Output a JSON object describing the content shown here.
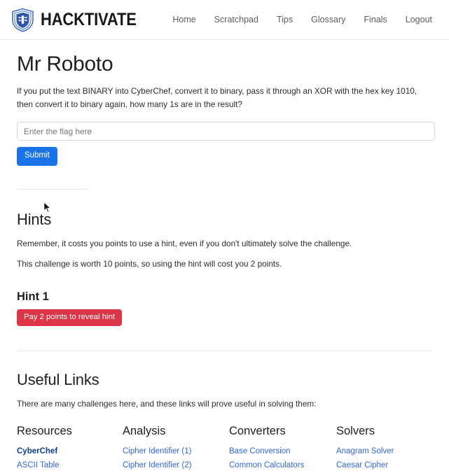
{
  "header": {
    "brand_name": "HACKTIVATE",
    "logo_icon": "shield-circuit-icon",
    "nav": [
      {
        "label": "Home"
      },
      {
        "label": "Scratchpad"
      },
      {
        "label": "Tips"
      },
      {
        "label": "Glossary"
      },
      {
        "label": "Finals"
      },
      {
        "label": "Logout"
      }
    ]
  },
  "challenge": {
    "title": "Mr Roboto",
    "prompt": "If you put the text BINARY into CyberChef, convert it to binary, pass it through an XOR with the hex key 1010, then convert it to binary again, how many 1s are in the result?",
    "flag_placeholder": "Enter the flag here",
    "flag_value": "",
    "submit_label": "Submit"
  },
  "hints": {
    "heading": "Hints",
    "note_1": "Remember, it costs you points to use a hint, even if you don't ultimately solve the challenge.",
    "note_2": "This challenge is worth 10 points, so using the hint will cost you 2 points.",
    "hint_1_title": "Hint 1",
    "hint_1_button": "Pay 2 points to reveal hint"
  },
  "useful_links": {
    "heading": "Useful Links",
    "intro": "There are many challenges here, and these links will prove useful in solving them:",
    "columns": [
      {
        "heading": "Resources",
        "items": [
          {
            "label": "CyberChef",
            "emphasis": true
          },
          {
            "label": "ASCII Table",
            "emphasis": false
          }
        ]
      },
      {
        "heading": "Analysis",
        "items": [
          {
            "label": "Cipher Identifier (1)",
            "emphasis": false
          },
          {
            "label": "Cipher Identifier (2)",
            "emphasis": false
          }
        ]
      },
      {
        "heading": "Converters",
        "items": [
          {
            "label": "Base Conversion",
            "emphasis": false
          },
          {
            "label": "Common Calculators",
            "emphasis": false
          }
        ]
      },
      {
        "heading": "Solvers",
        "items": [
          {
            "label": "Anagram Solver",
            "emphasis": false
          },
          {
            "label": "Caesar Cipher",
            "emphasis": false
          }
        ]
      }
    ]
  },
  "colors": {
    "brand_blue": "#1a73e8",
    "link_blue": "#3367d6",
    "visited_link_blue": "#0b3f96",
    "danger_red": "#dc3545",
    "nav_gray": "#5c6066",
    "logo_blue": "#3a63b8"
  }
}
